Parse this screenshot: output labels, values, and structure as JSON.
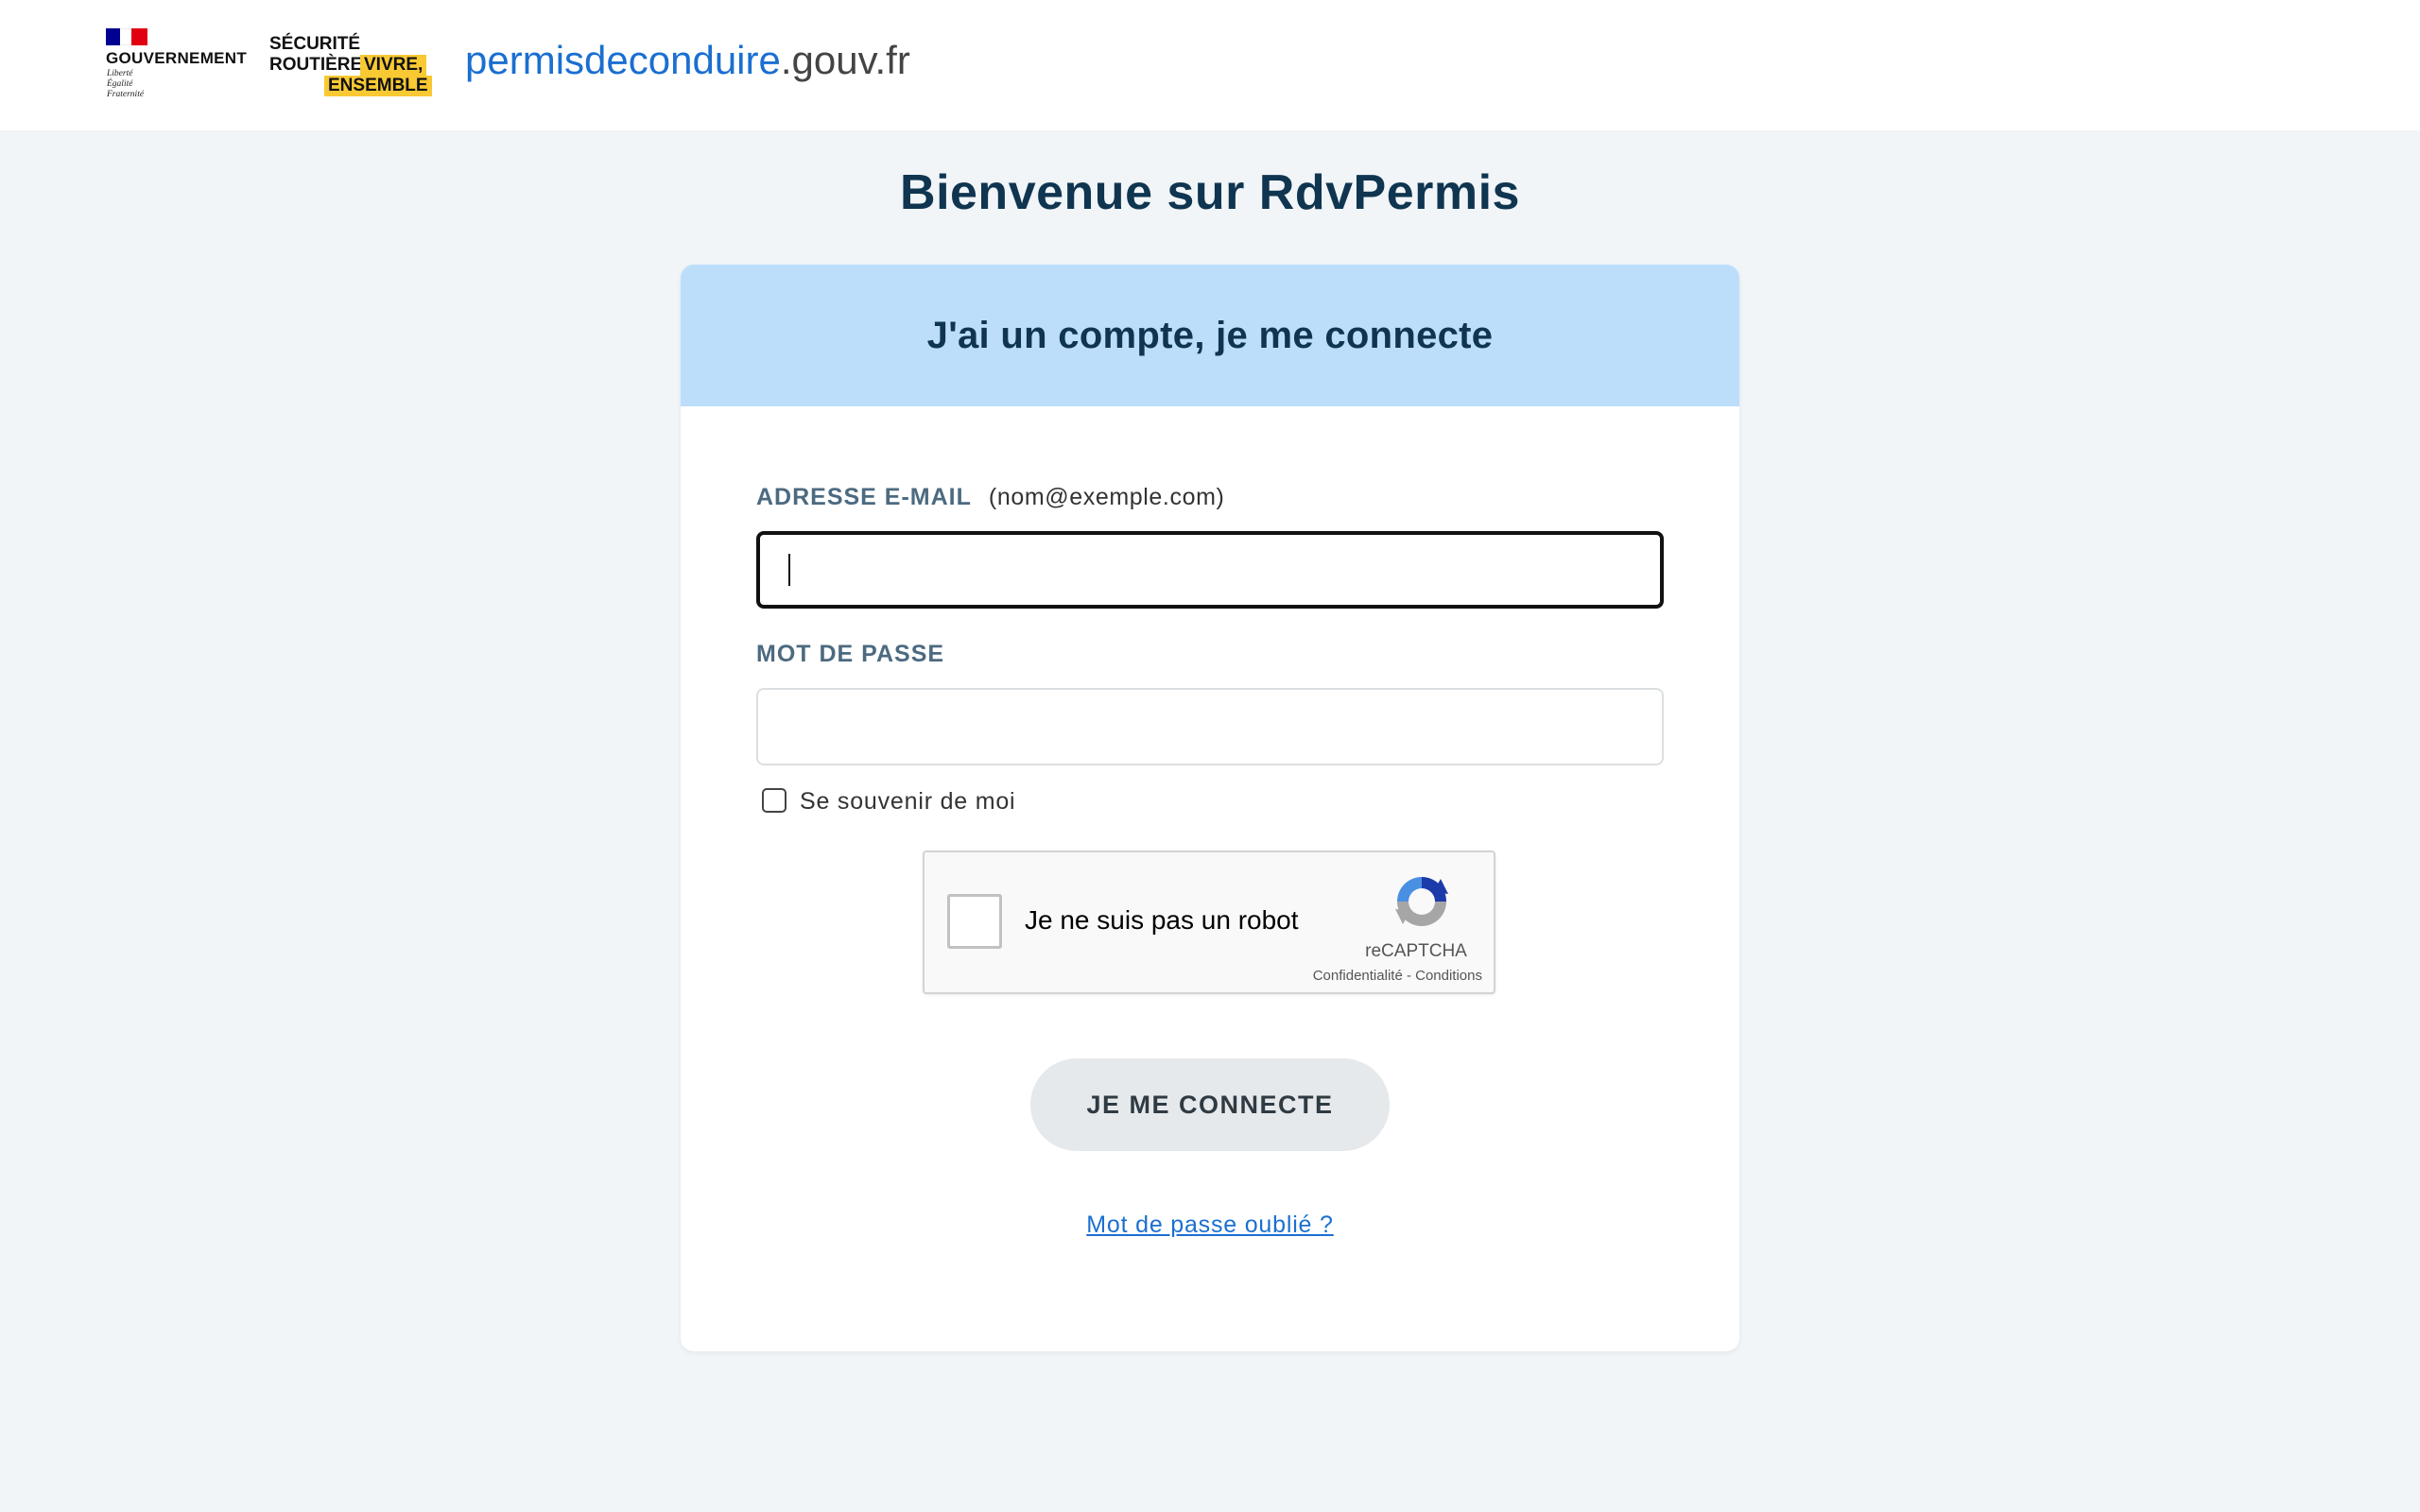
{
  "header": {
    "gov_logo": {
      "name": "GOUVERNEMENT",
      "motto": [
        "Liberté",
        "Égalité",
        "Fraternité"
      ]
    },
    "sr_logo": {
      "line1": "SÉCURITÉ",
      "line2": "ROUTIÈRE",
      "badge1": "VIVRE,",
      "badge2": "ENSEMBLE"
    },
    "site_name_blue": "permisdeconduire",
    "site_name_grey": ".gouv.fr"
  },
  "page": {
    "title": "Bienvenue sur RdvPermis"
  },
  "login_card": {
    "title": "J'ai un compte, je me connecte",
    "email_label": "ADRESSE E-MAIL",
    "email_hint": "(nom@exemple.com)",
    "email_value": "",
    "password_label": "MOT DE PASSE",
    "password_value": "",
    "remember_label": "Se souvenir de moi",
    "remember_checked": false,
    "submit_label": "JE ME CONNECTE",
    "forgot_password": "Mot de passe oublié ?"
  },
  "recaptcha": {
    "label": "Je ne suis pas un robot",
    "brand": "reCAPTCHA",
    "links": "Confidentialité - Conditions",
    "checked": false
  },
  "colors": {
    "brand_blue": "#1a6fd1",
    "title_navy": "#0f3550",
    "card_header_bg": "#bcdefb",
    "page_bg": "#f1f5f8",
    "badge_yellow": "#f8c933"
  }
}
